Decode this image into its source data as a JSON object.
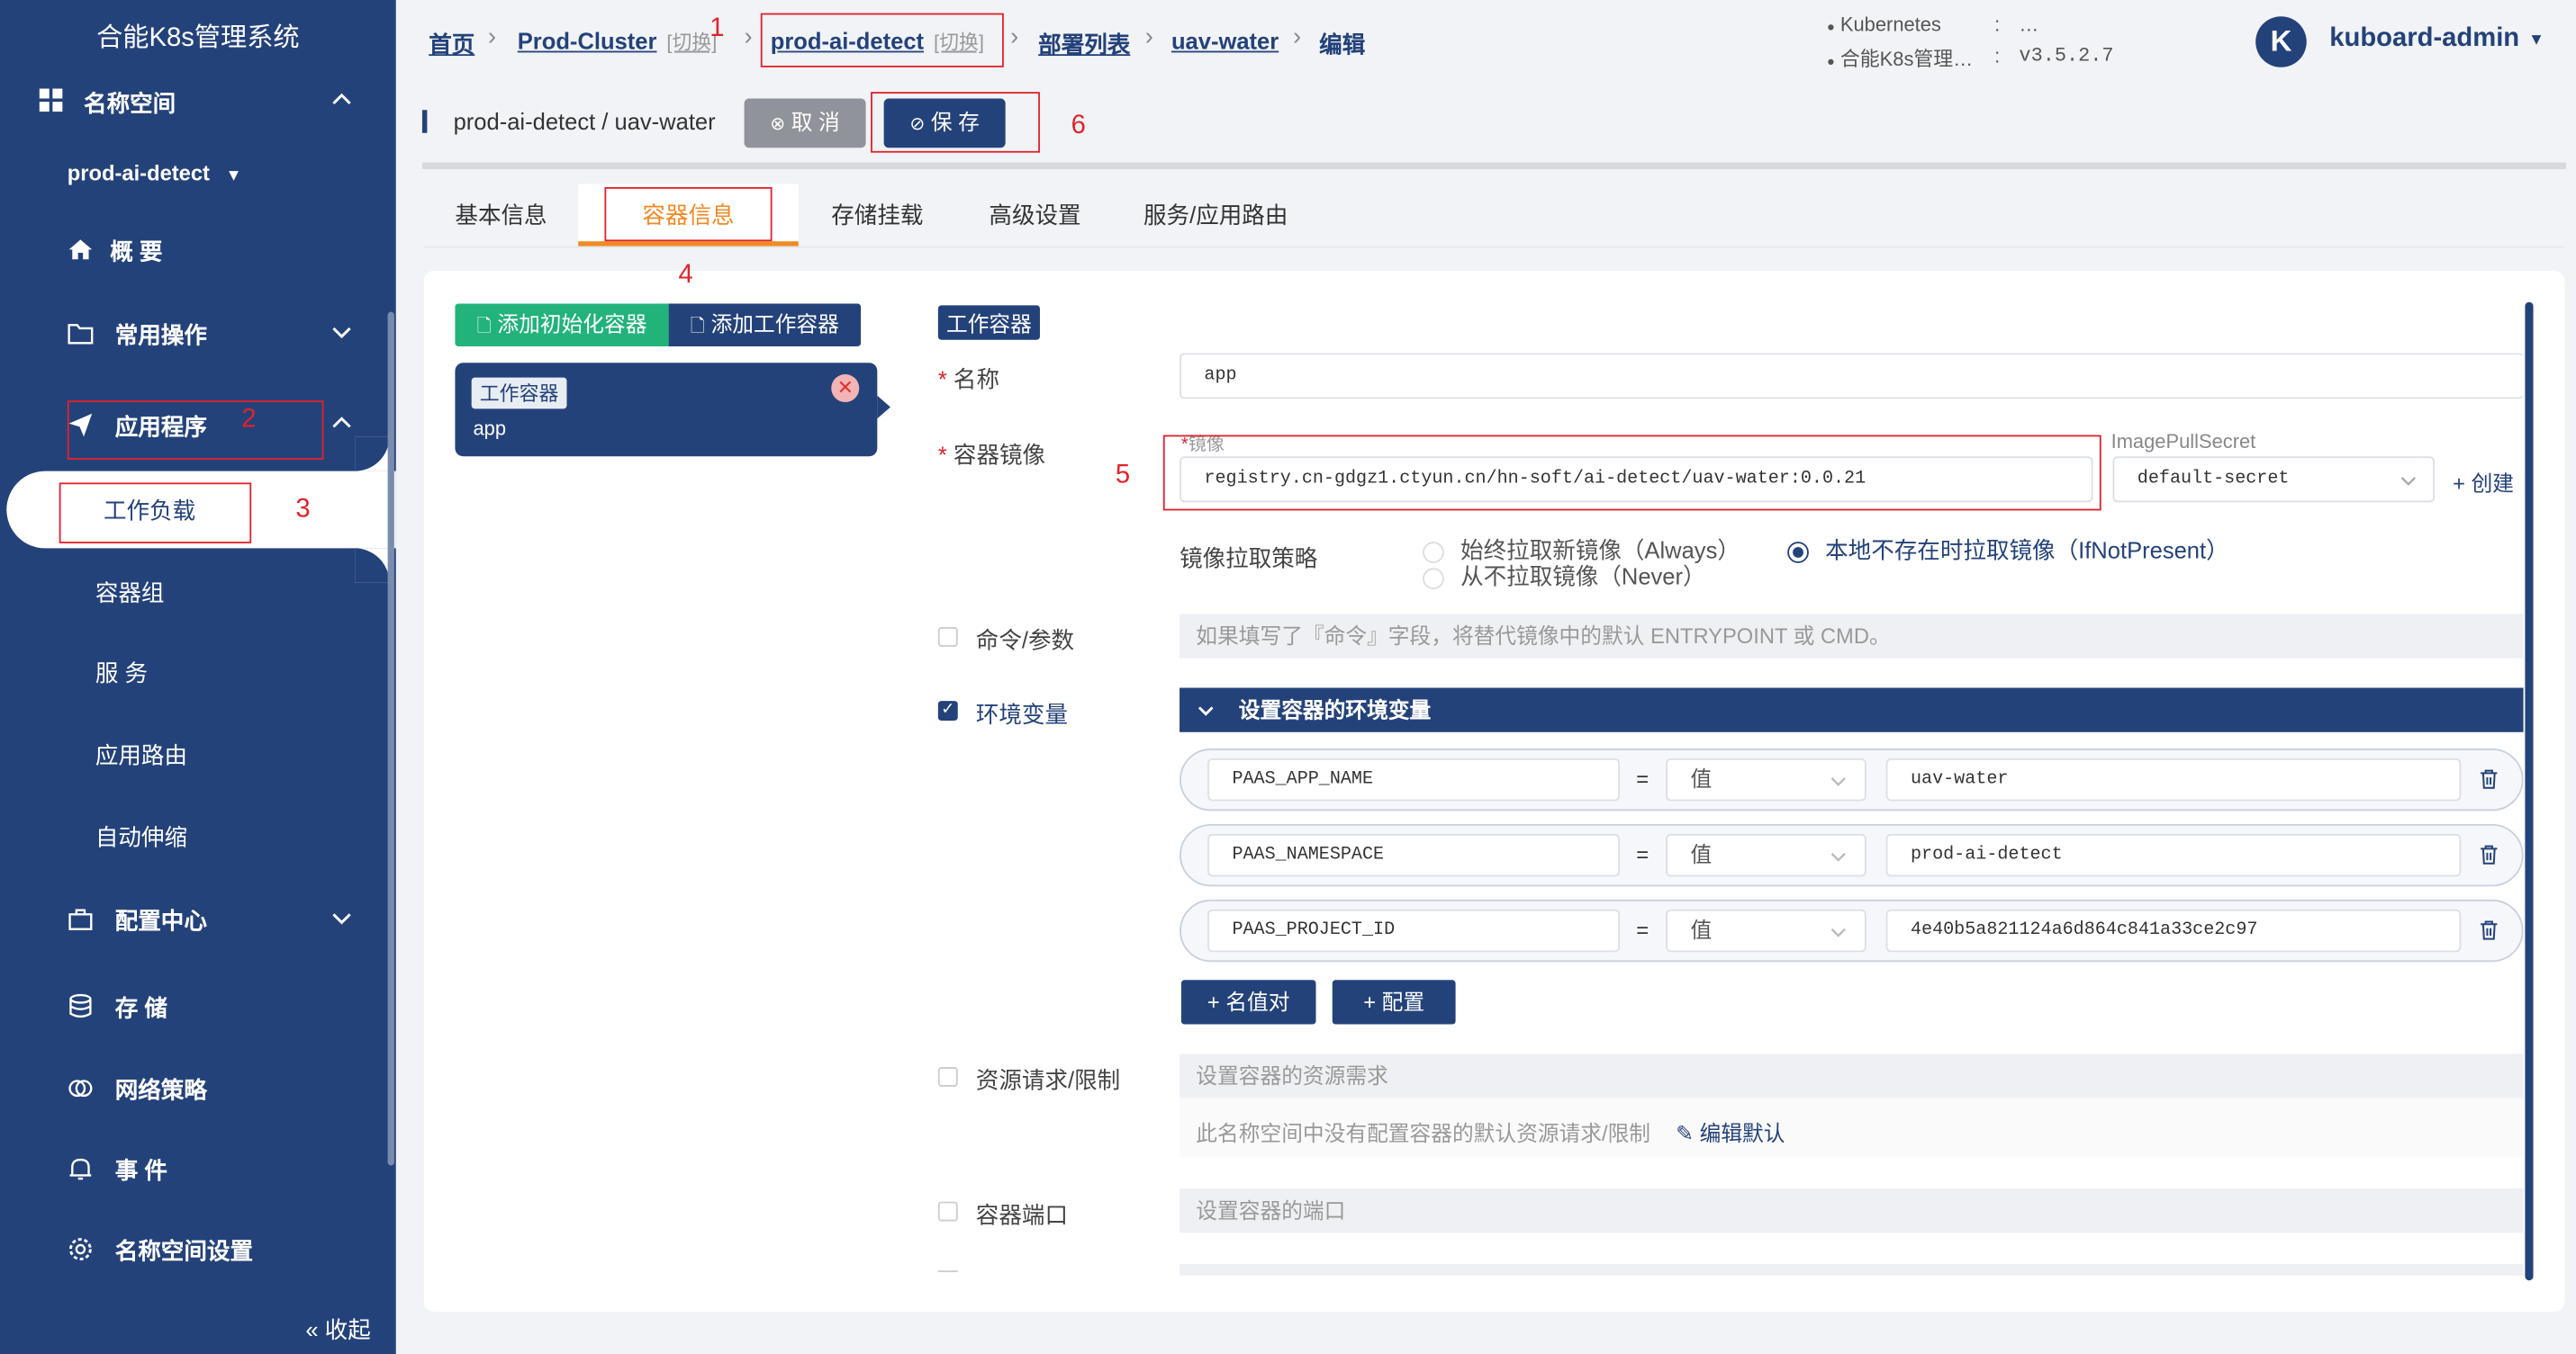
{
  "sidebar": {
    "title": "合能K8s管理系统",
    "namespace_header": "名称空间",
    "namespace_value": "prod-ai-detect",
    "items": {
      "overview": "概 要",
      "common_ops": "常用操作",
      "applications": "应用程序",
      "workloads": "工作负载",
      "pods": "容器组",
      "services": "服 务",
      "ingress": "应用路由",
      "autoscale": "自动伸缩",
      "config_center": "配置中心",
      "storage": "存 储",
      "network_policy": "网络策略",
      "events": "事 件",
      "ns_settings": "名称空间设置"
    },
    "collapse": "« 收起"
  },
  "breadcrumb": {
    "home": "首页",
    "cluster": "Prod-Cluster",
    "cluster_switch": "[切换]",
    "namespace": "prod-ai-detect",
    "namespace_switch": "[切换]",
    "deployments": "部署列表",
    "workload": "uav-water",
    "edit": "编辑"
  },
  "version": {
    "k8s_label": "Kubernetes",
    "k8s_sep": ":",
    "k8s_value": "…",
    "app_label": "合能K8s管理…",
    "app_sep": ":",
    "app_value": "v3.5.2.7"
  },
  "user": {
    "avatar_letter": "K",
    "name": "kuboard-admin"
  },
  "toolbar": {
    "path": "prod-ai-detect / uav-water",
    "cancel": "取 消",
    "save": "保 存"
  },
  "tabs": [
    "基本信息",
    "容器信息",
    "存储挂载",
    "高级设置",
    "服务/应用路由"
  ],
  "containers": {
    "add_init": "添加初始化容器",
    "add_work": "添加工作容器",
    "card_tag": "工作容器",
    "card_name": "app"
  },
  "form": {
    "section_tag": "工作容器",
    "name_label": "名称",
    "name_value": "app",
    "image_label": "容器镜像",
    "image_field_label": "镜像",
    "image_value": "registry.cn-gdgz1.ctyun.cn/hn-soft/ai-detect/uav-water:0.0.21",
    "pull_secret_label": "ImagePullSecret",
    "pull_secret_value": "default-secret",
    "create_link": "+ 创建",
    "pull_policy_label": "镜像拉取策略",
    "policy_always": "始终拉取新镜像（Always）",
    "policy_never": "从不拉取镜像（Never）",
    "policy_ifnotpresent": "本地不存在时拉取镜像（IfNotPresent）",
    "cmd_label": "命令/参数",
    "cmd_placeholder": "如果填写了『命令』字段，将替代镜像中的默认 ENTRYPOINT 或 CMD。",
    "env_label": "环境变量",
    "env_header": "设置容器的环境变量",
    "env_rows": [
      {
        "name": "PAAS_APP_NAME",
        "eq": "=",
        "type": "值",
        "value": "uav-water"
      },
      {
        "name": "PAAS_NAMESPACE",
        "eq": "=",
        "type": "值",
        "value": "prod-ai-detect"
      },
      {
        "name": "PAAS_PROJECT_ID",
        "eq": "=",
        "type": "值",
        "value": "4e40b5a821124a6d864c841a33ce2c97"
      }
    ],
    "add_kv": "+ 名值对",
    "add_config": "+ 配置",
    "resource_label": "资源请求/限制",
    "resource_header": "设置容器的资源需求",
    "resource_note": "此名称空间中没有配置容器的默认资源请求/限制",
    "edit_default": "编辑默认",
    "ports_label": "容器端口",
    "ports_header": "设置容器的端口"
  },
  "annotations": [
    "1",
    "2",
    "3",
    "4",
    "5",
    "6"
  ],
  "colors": {
    "sidebar": "#24427a",
    "accent_orange": "#f08a24",
    "green": "#22b37b",
    "annotation_red": "#e0232b"
  }
}
